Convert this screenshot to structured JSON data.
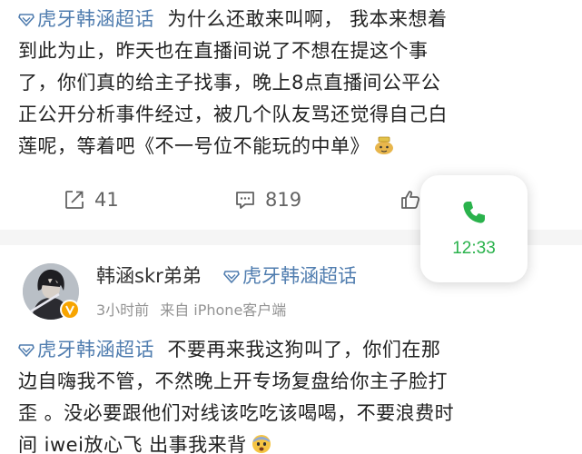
{
  "post1": {
    "topic": "虎牙韩涵超话",
    "lines": [
      "为什么还敢来叫啊， 我本来想着",
      "到此为止，昨天也在直播间说了不想在提这个事",
      "了，你们真的给主子找事，晚上8点直播间公平公",
      "正公开分析事件经过，被几个队友骂还觉得自己白",
      "莲呢，等着吧《不一号位不能玩的中单》"
    ],
    "emoji": "doge-emoji",
    "share_count": "41",
    "comment_count": "819"
  },
  "call_widget": {
    "time": "12:33",
    "color": "#2ab24c"
  },
  "post2": {
    "author": "韩涵skr弟弟",
    "author_topic": "虎牙韩涵超话",
    "time_ago": "3小时前",
    "source": "来自 iPhone客户端",
    "topic": "虎牙韩涵超话",
    "lines": [
      "不要再来我这狗叫了，你们在那",
      "边自嗨我不管，不然晚上开专场复盘给你主子脸打",
      "歪 。没必要跟他们对线该吃吃该喝喝，不要浪费时",
      "间 iwei放心飞  出事我来背"
    ],
    "emoji": "fearful-emoji"
  },
  "colors": {
    "topic": "#507daf",
    "text": "#222222",
    "meta": "#939393",
    "action": "#636363"
  }
}
